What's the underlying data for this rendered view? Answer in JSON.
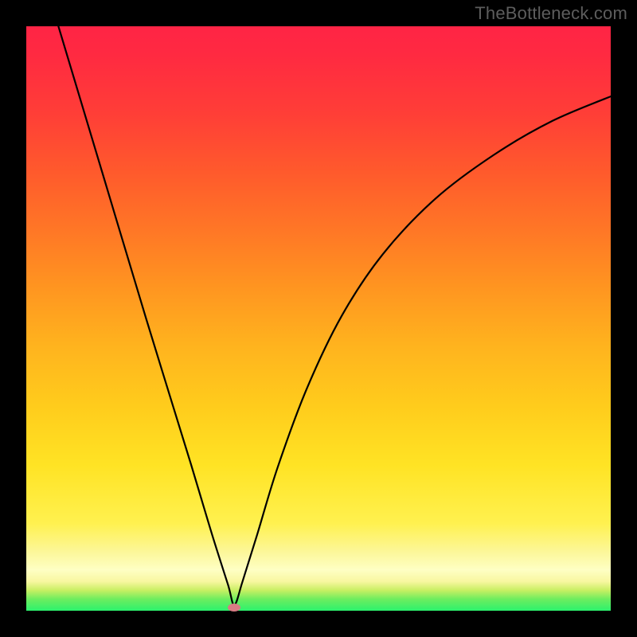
{
  "watermark": "TheBottleneck.com",
  "colors": {
    "frame": "#000000",
    "watermark_text": "#5d5d5d",
    "curve_stroke": "#000000",
    "marker_fill": "#d87b84",
    "gradient_stops": [
      {
        "pos": 0.0,
        "hex": "#2cf26d"
      },
      {
        "pos": 0.02,
        "hex": "#6eed5f"
      },
      {
        "pos": 0.035,
        "hex": "#c8ef63"
      },
      {
        "pos": 0.05,
        "hex": "#f8f7a0"
      },
      {
        "pos": 0.07,
        "hex": "#feffc4"
      },
      {
        "pos": 0.1,
        "hex": "#fcf79a"
      },
      {
        "pos": 0.15,
        "hex": "#fff14f"
      },
      {
        "pos": 0.25,
        "hex": "#ffe324"
      },
      {
        "pos": 0.35,
        "hex": "#ffcc1c"
      },
      {
        "pos": 0.45,
        "hex": "#ffb41e"
      },
      {
        "pos": 0.55,
        "hex": "#ff9620"
      },
      {
        "pos": 0.65,
        "hex": "#ff7726"
      },
      {
        "pos": 0.75,
        "hex": "#ff5a2c"
      },
      {
        "pos": 0.85,
        "hex": "#ff3e37"
      },
      {
        "pos": 0.95,
        "hex": "#ff2a41"
      },
      {
        "pos": 1.0,
        "hex": "#ff2445"
      }
    ]
  },
  "chart_data": {
    "type": "line",
    "title": "",
    "xlabel": "",
    "ylabel": "",
    "xlim": [
      0,
      1
    ],
    "ylim": [
      0,
      1
    ],
    "grid": false,
    "legend": false,
    "comment": "Axis units are not labeled in the image; coordinates are normalized to the plot area (0,0 = bottom-left, 1,1 = top-right). Values are read off pixel positions.",
    "series": [
      {
        "name": "left-branch",
        "comment": "Near-straight descending segment from the top-left down to the valley minimum.",
        "points": [
          {
            "x": 0.055,
            "y": 1.0
          },
          {
            "x": 0.13,
            "y": 0.75
          },
          {
            "x": 0.205,
            "y": 0.5
          },
          {
            "x": 0.282,
            "y": 0.25
          },
          {
            "x": 0.318,
            "y": 0.13
          },
          {
            "x": 0.345,
            "y": 0.045
          },
          {
            "x": 0.356,
            "y": 0.01
          }
        ]
      },
      {
        "name": "right-branch",
        "comment": "Curved ascending segment from the valley minimum, rising quickly then flattening toward the right edge.",
        "points": [
          {
            "x": 0.356,
            "y": 0.01
          },
          {
            "x": 0.37,
            "y": 0.05
          },
          {
            "x": 0.395,
            "y": 0.13
          },
          {
            "x": 0.43,
            "y": 0.245
          },
          {
            "x": 0.48,
            "y": 0.38
          },
          {
            "x": 0.54,
            "y": 0.505
          },
          {
            "x": 0.61,
            "y": 0.61
          },
          {
            "x": 0.7,
            "y": 0.705
          },
          {
            "x": 0.8,
            "y": 0.78
          },
          {
            "x": 0.9,
            "y": 0.838
          },
          {
            "x": 1.0,
            "y": 0.88
          }
        ]
      }
    ],
    "marker": {
      "name": "valley-marker",
      "x": 0.356,
      "y": 0.006,
      "shape": "ellipse",
      "fill": "#d87b84"
    }
  }
}
